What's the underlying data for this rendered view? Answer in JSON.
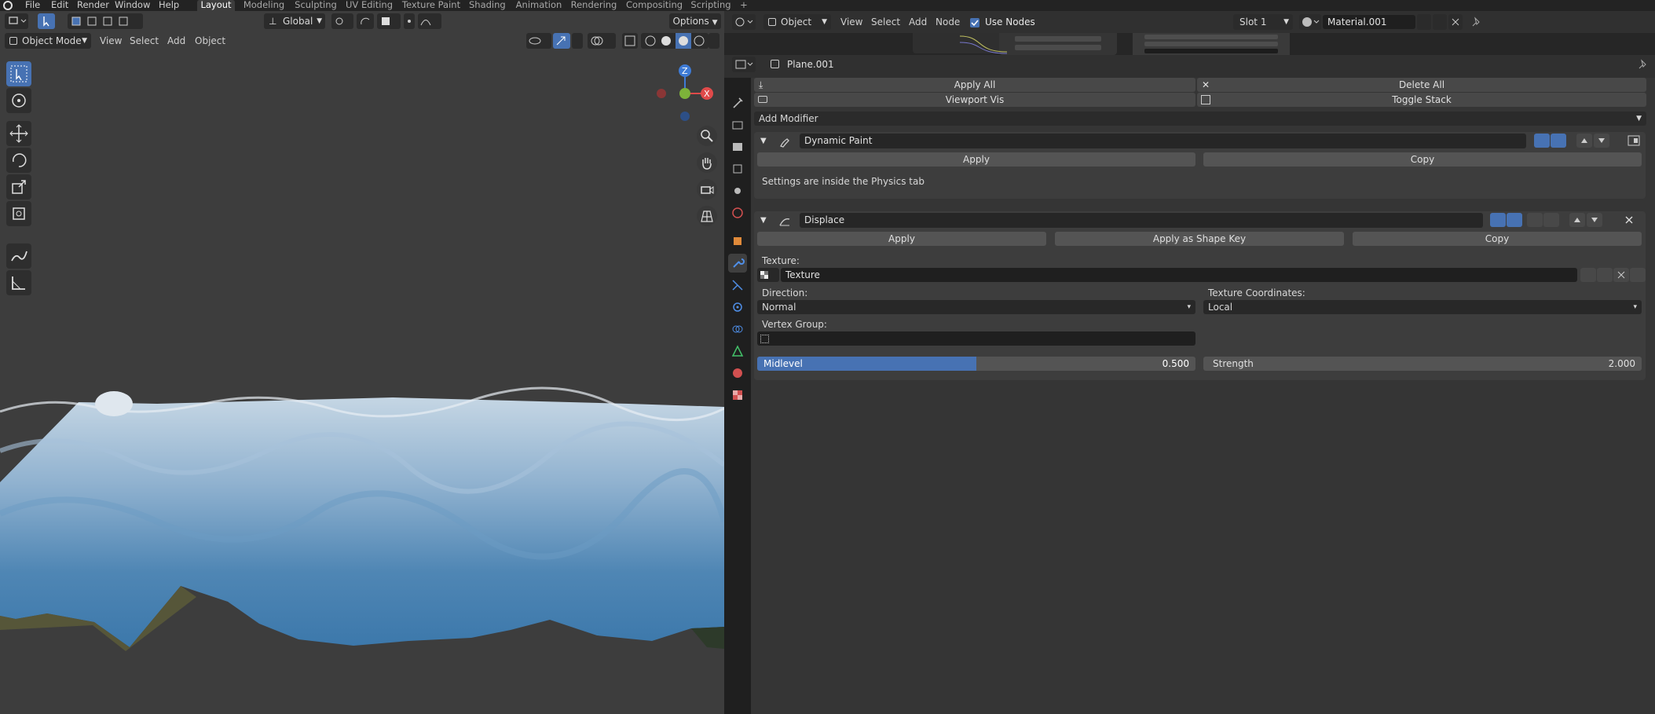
{
  "topbar": {
    "menus": [
      "File",
      "Edit",
      "Render",
      "Window",
      "Help"
    ],
    "workspaces": [
      "Layout",
      "Modeling",
      "Sculpting",
      "UV Editing",
      "Texture Paint",
      "Shading",
      "Animation",
      "Rendering",
      "Compositing",
      "Scripting"
    ],
    "active_workspace": "Layout",
    "add_tab": "+"
  },
  "viewport": {
    "transform_orientation": "Global",
    "options_label": "Options",
    "mode": "Object Mode",
    "menus": [
      "View",
      "Select",
      "Add",
      "Object"
    ],
    "gizmo": {
      "z": "Z",
      "x": "X"
    }
  },
  "node_editor": {
    "editor_type": "Object",
    "menus": [
      "View",
      "Select",
      "Add",
      "Node"
    ],
    "use_nodes_label": "Use Nodes",
    "use_nodes": true,
    "slot": "Slot 1",
    "material": "Material.001"
  },
  "properties": {
    "object_name": "Plane.001",
    "stack_buttons": {
      "apply_all": "Apply All",
      "delete_all": "Delete All",
      "viewport_vis": "Viewport Vis",
      "toggle_stack": "Toggle Stack"
    },
    "add_modifier": "Add Modifier",
    "dynamic_paint": {
      "name": "Dynamic Paint",
      "apply": "Apply",
      "copy": "Copy",
      "note": "Settings are inside the Physics tab"
    },
    "displace": {
      "name": "Displace",
      "apply": "Apply",
      "apply_shape_key": "Apply as Shape Key",
      "copy": "Copy",
      "texture_label": "Texture:",
      "texture_value": "Texture",
      "direction_label": "Direction:",
      "direction_value": "Normal",
      "coords_label": "Texture Coordinates:",
      "coords_value": "Local",
      "vertex_group_label": "Vertex Group:",
      "midlevel_label": "Midlevel",
      "midlevel_value": "0.500",
      "midlevel_fraction": 0.5,
      "strength_label": "Strength",
      "strength_value": "2.000"
    }
  },
  "colors": {
    "accent": "#4772b3",
    "x_axis": "#e04a4a",
    "y_axis": "#8bc34a",
    "z_axis": "#3e7bd6"
  }
}
